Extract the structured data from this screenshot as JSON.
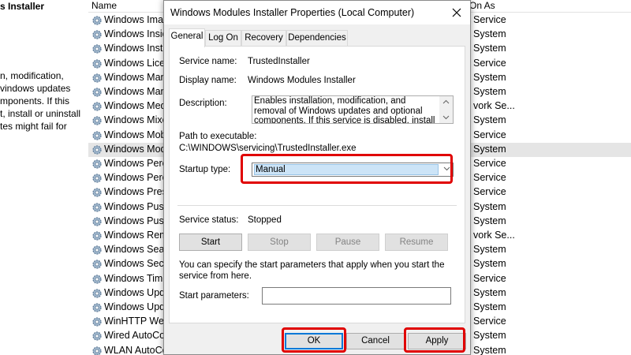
{
  "background": {
    "left_pane": {
      "title": "s Installer",
      "description_lines": [
        "n, modification,",
        "vindows updates",
        "mponents. If this",
        "t, install or uninstall",
        "tes might fail for"
      ]
    },
    "columns": {
      "name": "Name",
      "logon": "On As"
    },
    "services": [
      {
        "name": "Windows Imag",
        "logon": "Service"
      },
      {
        "name": "Windows Insid",
        "logon": "System"
      },
      {
        "name": "Windows Insta",
        "logon": "System"
      },
      {
        "name": "Windows Licen",
        "logon": "Service"
      },
      {
        "name": "Windows Mana",
        "logon": "System"
      },
      {
        "name": "Windows Mana",
        "logon": "System"
      },
      {
        "name": "Windows Medi",
        "logon": "vork Se..."
      },
      {
        "name": "Windows Mixe",
        "logon": "System"
      },
      {
        "name": "Windows Mob",
        "logon": "Service"
      },
      {
        "name": "Windows Mod",
        "logon": "System",
        "selected": true
      },
      {
        "name": "Windows Perce",
        "logon": "Service"
      },
      {
        "name": "Windows Perce",
        "logon": "Service"
      },
      {
        "name": "Windows Prese",
        "logon": "Service"
      },
      {
        "name": "Windows Push",
        "logon": "System"
      },
      {
        "name": "Windows Push",
        "logon": "System"
      },
      {
        "name": "Windows Remo",
        "logon": "vork Se..."
      },
      {
        "name": "Windows Searc",
        "logon": "System"
      },
      {
        "name": "Windows Secu",
        "logon": "System"
      },
      {
        "name": "Windows Time",
        "logon": "Service"
      },
      {
        "name": "Windows Upda",
        "logon": "System"
      },
      {
        "name": "Windows Upda",
        "logon": "System"
      },
      {
        "name": "WinHTTP Web",
        "logon": "Service"
      },
      {
        "name": "Wired AutoCo",
        "logon": "System"
      },
      {
        "name": "WLAN AutoCo",
        "logon": "System"
      }
    ]
  },
  "dialog": {
    "title": "Windows Modules Installer Properties (Local Computer)",
    "tabs": [
      "General",
      "Log On",
      "Recovery",
      "Dependencies"
    ],
    "active_tab": "General",
    "service_name_label": "Service name:",
    "service_name_value": "TrustedInstaller",
    "display_name_label": "Display name:",
    "display_name_value": "Windows Modules Installer",
    "description_label": "Description:",
    "description_value": "Enables installation, modification, and removal of Windows updates and optional components. If this service is disabled, install or uninstall of Windows",
    "path_label": "Path to executable:",
    "path_value": "C:\\WINDOWS\\servicing\\TrustedInstaller.exe",
    "startup_type_label": "Startup type:",
    "startup_type_value": "Manual",
    "service_status_label": "Service status:",
    "service_status_value": "Stopped",
    "buttons": {
      "start": "Start",
      "stop": "Stop",
      "pause": "Pause",
      "resume": "Resume"
    },
    "start_params_hint": "You can specify the start parameters that apply when you start the service from here.",
    "start_params_label": "Start parameters:",
    "start_params_value": "",
    "footer": {
      "ok": "OK",
      "cancel": "Cancel",
      "apply": "Apply"
    }
  },
  "colors": {
    "highlight": "#e00000",
    "selection": "#cce4f7",
    "focus_border": "#0078d7"
  },
  "icons": {
    "service": "gear-icon",
    "close": "close-icon",
    "dropdown": "chevron-down-icon"
  }
}
